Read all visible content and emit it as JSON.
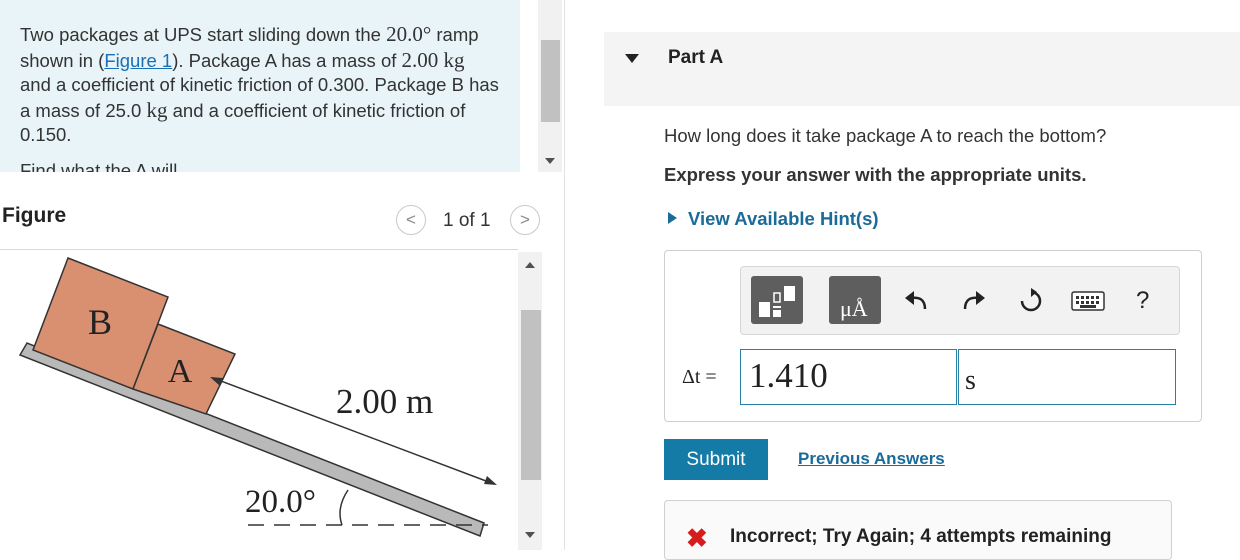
{
  "problem": {
    "text_1": "Two packages at UPS start sliding down the ",
    "angle": "20.0°",
    "text_2": " ramp shown in (",
    "figure_link": "Figure 1",
    "text_3": "). Package A has a mass of ",
    "mass_a": "2.00 kg",
    "text_4": " and a coefficient of kinetic friction of 0.300. Package B has a mass of 25.0 ",
    "unit_kg": "kg",
    "text_5": " and a coefficient of kinetic friction of 0.150.",
    "clipped_line": "Find what the A will..."
  },
  "figure": {
    "title": "Figure",
    "pager": "1 of 1",
    "prev_glyph": "<",
    "next_glyph": ">",
    "label_b": "B",
    "label_a": "A",
    "distance": "2.00 m",
    "angle": "20.0°"
  },
  "part": {
    "title": "Part A",
    "question": "How long does it take package A to reach the bottom?",
    "instructions": "Express your answer with the appropriate units.",
    "hint_label": "View Available Hint(s)"
  },
  "answer": {
    "symbol": "Δt =",
    "value": "1.410",
    "units": "s"
  },
  "toolbar": {
    "templates_icon": "templates-icon",
    "units_icon": "units-icon",
    "units_glyph": "μÅ",
    "undo_icon": "undo-icon",
    "redo_icon": "redo-icon",
    "reset_icon": "reset-icon",
    "keyboard_icon": "keyboard-icon",
    "help_glyph": "?"
  },
  "actions": {
    "submit": "Submit",
    "previous_answers": "Previous Answers"
  },
  "feedback": {
    "mark": "✖",
    "text": "Incorrect; Try Again; 4 attempts remaining"
  },
  "colors": {
    "accent": "#137ba6",
    "link": "#1a6b9a",
    "error": "#d61c1c",
    "block": "#d99070",
    "panel_bg": "#e8f4f7"
  }
}
